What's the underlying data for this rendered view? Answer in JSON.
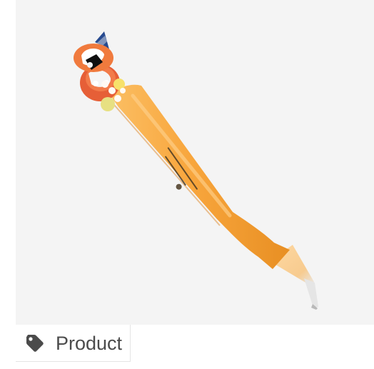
{
  "image": {
    "alt": "Product",
    "icon": "tag-icon"
  },
  "badge": {
    "label": "Product"
  },
  "colors": {
    "image_background": "#f4f4f4",
    "pen_body": "#f6a23a",
    "icon": "#4b4b4b",
    "text": "#4b4b4b"
  }
}
